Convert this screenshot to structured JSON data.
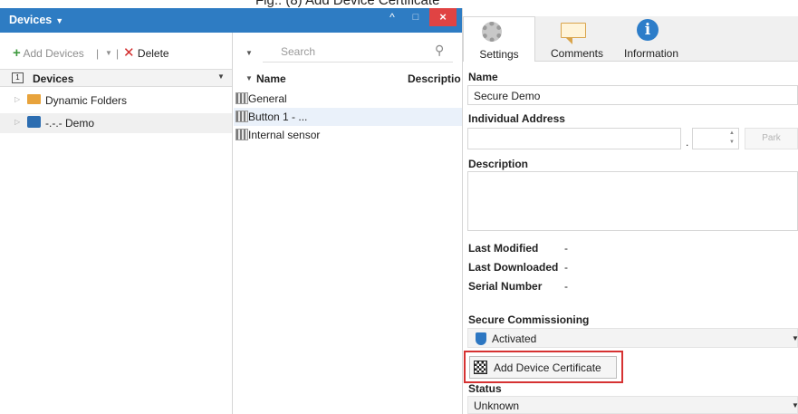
{
  "caption": "Fig.: (8) Add Device Certificate",
  "window": {
    "title": "Devices",
    "up_glyph": "^",
    "max_glyph": "□",
    "close_glyph": "×"
  },
  "toolbar": {
    "add_devices": "Add Devices",
    "delete": "Delete",
    "search_placeholder": "Search"
  },
  "tree": {
    "header": "Devices",
    "items": [
      {
        "label": "Dynamic Folders",
        "icon": "folder-icon"
      },
      {
        "label": "-.-.- Demo",
        "icon": "device-icon"
      }
    ]
  },
  "list": {
    "columns": [
      "Name",
      "Descriptio"
    ],
    "rows": [
      "General",
      "Button 1 - ...",
      "Internal sensor"
    ],
    "selected_index": 1
  },
  "tabs": [
    "Settings",
    "Comments",
    "Information"
  ],
  "settings": {
    "name_label": "Name",
    "name_value": "Secure Demo",
    "individual_address_label": "Individual Address",
    "address_separator": ".",
    "park_label": "Park",
    "description_label": "Description",
    "info": [
      {
        "key": "Last Modified",
        "value": "-"
      },
      {
        "key": "Last Downloaded",
        "value": "-"
      },
      {
        "key": "Serial Number",
        "value": "-"
      }
    ],
    "secure_commissioning_label": "Secure Commissioning",
    "secure_commissioning_value": "Activated",
    "add_certificate_button": "Add Device Certificate",
    "status_label": "Status",
    "status_value": "Unknown"
  },
  "colors": {
    "titlebar": "#2e7cc3",
    "close": "#e04343",
    "highlight_border": "#d63232",
    "selected_row": "#eaf1fa"
  }
}
